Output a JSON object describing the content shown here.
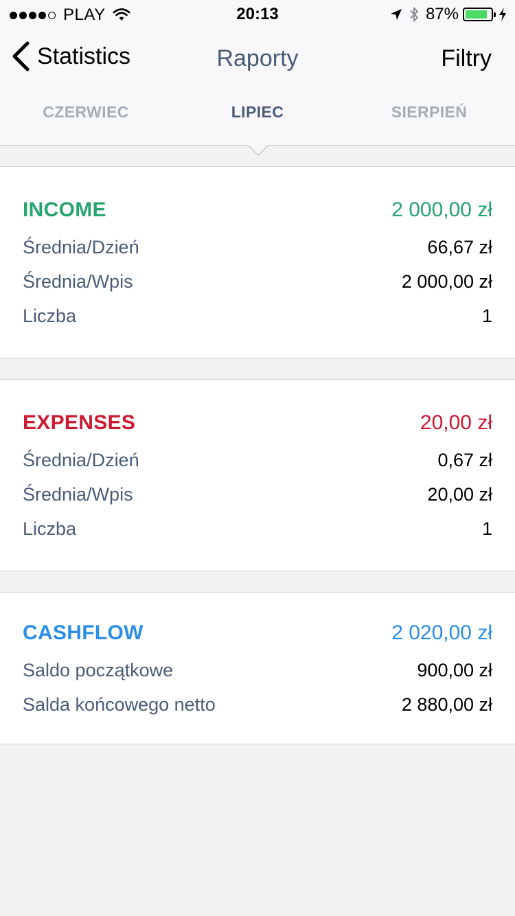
{
  "status_bar": {
    "carrier": "PLAY",
    "signal_bars_filled": 4,
    "signal_bars_total": 5,
    "time": "20:13",
    "battery_percent": "87%",
    "battery_level": 0.87,
    "battery_color": "#4cd964"
  },
  "nav": {
    "back_label": "Statistics",
    "title": "Raporty",
    "right_label": "Filtry"
  },
  "tabs": {
    "items": [
      {
        "label": "CZERWIEC",
        "selected": false
      },
      {
        "label": "LIPIEC",
        "selected": true
      },
      {
        "label": "SIERPIEŃ",
        "selected": false
      }
    ]
  },
  "income": {
    "title": "INCOME",
    "total": "2 000,00 zł",
    "color": "#27a56f",
    "rows": [
      {
        "label": "Średnia/Dzień",
        "value": "66,67 zł"
      },
      {
        "label": "Średnia/Wpis",
        "value": "2 000,00 zł"
      },
      {
        "label": "Liczba",
        "value": "1"
      }
    ]
  },
  "expenses": {
    "title": "EXPENSES",
    "total": "20,00 zł",
    "color": "#cc1a33",
    "rows": [
      {
        "label": "Średnia/Dzień",
        "value": "0,67 zł"
      },
      {
        "label": "Średnia/Wpis",
        "value": "20,00 zł"
      },
      {
        "label": "Liczba",
        "value": "1"
      }
    ]
  },
  "cashflow": {
    "title": "CASHFLOW",
    "total": "2 020,00 zł",
    "color": "#2b8ee6",
    "rows": [
      {
        "label": "Saldo początkowe",
        "value": "900,00 zł"
      },
      {
        "label": "Salda końcowego netto",
        "value": "2 880,00 zł"
      }
    ]
  }
}
